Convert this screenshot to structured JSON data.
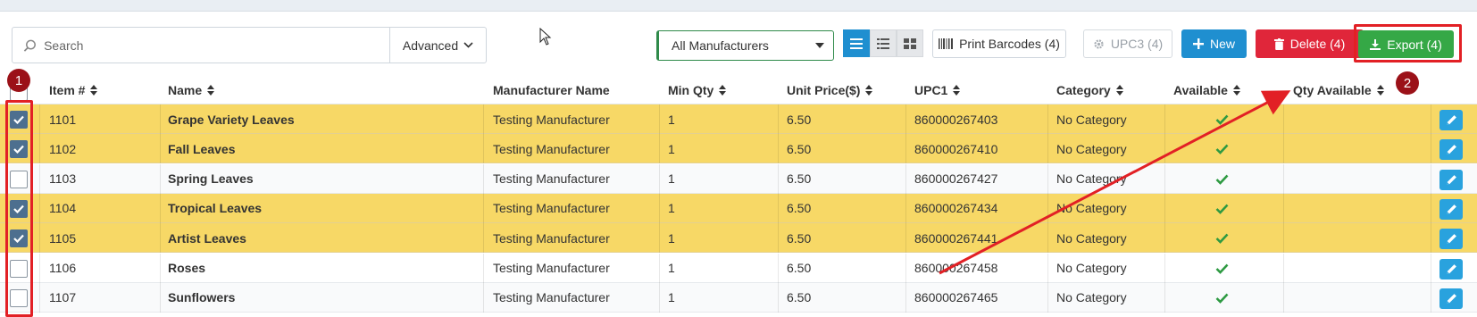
{
  "toolbar": {
    "search_placeholder": "Search",
    "advanced_label": "Advanced",
    "manufacturer_select": "All Manufacturers",
    "print_barcodes_label": "Print Barcodes (4)",
    "upc3_label": "UPC3 (4)",
    "new_label": "New",
    "delete_label": "Delete (4)",
    "export_label": "Export (4)"
  },
  "columns": {
    "item": "Item #",
    "name": "Name",
    "manufacturer": "Manufacturer Name",
    "min_qty": "Min Qty",
    "unit_price": "Unit Price($)",
    "upc1": "UPC1",
    "category": "Category",
    "available": "Available",
    "qty_available": "Qty Available"
  },
  "rows": [
    {
      "item": "1101",
      "name": "Grape Variety Leaves",
      "manufacturer": "Testing Manufacturer",
      "min_qty": "1",
      "unit_price": "6.50",
      "upc1": "860000267403",
      "category": "No Category",
      "selected": true
    },
    {
      "item": "1102",
      "name": "Fall Leaves",
      "manufacturer": "Testing Manufacturer",
      "min_qty": "1",
      "unit_price": "6.50",
      "upc1": "860000267410",
      "category": "No Category",
      "selected": true
    },
    {
      "item": "1103",
      "name": "Spring Leaves",
      "manufacturer": "Testing Manufacturer",
      "min_qty": "1",
      "unit_price": "6.50",
      "upc1": "860000267427",
      "category": "No Category",
      "selected": false
    },
    {
      "item": "1104",
      "name": "Tropical Leaves",
      "manufacturer": "Testing Manufacturer",
      "min_qty": "1",
      "unit_price": "6.50",
      "upc1": "860000267434",
      "category": "No Category",
      "selected": true
    },
    {
      "item": "1105",
      "name": "Artist Leaves",
      "manufacturer": "Testing Manufacturer",
      "min_qty": "1",
      "unit_price": "6.50",
      "upc1": "860000267441",
      "category": "No Category",
      "selected": true
    },
    {
      "item": "1106",
      "name": "Roses",
      "manufacturer": "Testing Manufacturer",
      "min_qty": "1",
      "unit_price": "6.50",
      "upc1": "860000267458",
      "category": "No Category",
      "selected": false
    },
    {
      "item": "1107",
      "name": "Sunflowers",
      "manufacturer": "Testing Manufacturer",
      "min_qty": "1",
      "unit_price": "6.50",
      "upc1": "860000267465",
      "category": "No Category",
      "selected": false
    }
  ],
  "annotations": {
    "marker_1": "1",
    "marker_2": "2"
  },
  "colors": {
    "selected_row": "#f7d866",
    "primary": "#1f8fd0",
    "danger": "#e0263a",
    "success": "#35a846",
    "annotation_red": "#e22025"
  },
  "icons": {
    "search": "search-icon",
    "advanced_caret": "chevron-down-icon",
    "list_view": "list-view-icon",
    "detail_view": "detail-list-icon",
    "grid_view": "grid-view-icon",
    "barcode": "barcode-icon",
    "upc": "gear-icon",
    "new": "plus-icon",
    "delete": "trash-icon",
    "export": "download-icon",
    "available": "checkmark-icon",
    "edit": "pencil-icon"
  }
}
